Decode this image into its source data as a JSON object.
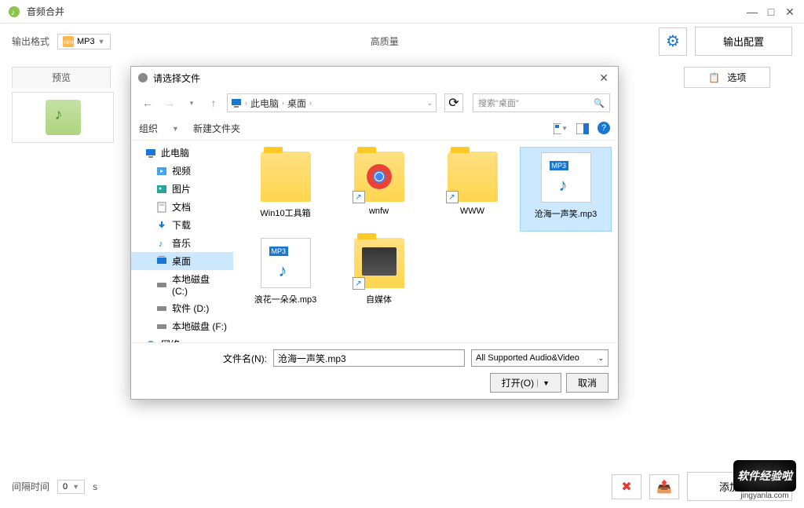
{
  "app": {
    "title": "音频合并"
  },
  "toolbar": {
    "format_label": "输出格式",
    "format_value": "MP3",
    "quality": "高质量",
    "output_config": "输出配置"
  },
  "main": {
    "preview_tab": "预览",
    "option_btn": "选项"
  },
  "bottom": {
    "interval_label": "间隔时间",
    "interval_value": "0",
    "interval_unit": "s",
    "add_file": "添加文件"
  },
  "dialog": {
    "title": "请选择文件",
    "breadcrumb": [
      "此电脑",
      "桌面"
    ],
    "search_placeholder": "搜索\"桌面\"",
    "organize": "组织",
    "new_folder": "新建文件夹",
    "sidebar": [
      {
        "label": "此电脑",
        "icon": "pc",
        "level": 1
      },
      {
        "label": "视频",
        "icon": "video",
        "level": 2
      },
      {
        "label": "图片",
        "icon": "image",
        "level": 2
      },
      {
        "label": "文档",
        "icon": "doc",
        "level": 2
      },
      {
        "label": "下载",
        "icon": "download",
        "level": 2
      },
      {
        "label": "音乐",
        "icon": "music",
        "level": 2
      },
      {
        "label": "桌面",
        "icon": "desktop",
        "level": 2,
        "selected": true
      },
      {
        "label": "本地磁盘 (C:)",
        "icon": "disk",
        "level": 2
      },
      {
        "label": "软件 (D:)",
        "icon": "disk",
        "level": 2
      },
      {
        "label": "本地磁盘 (F:)",
        "icon": "disk",
        "level": 2
      },
      {
        "label": "网络",
        "icon": "network",
        "level": 1
      }
    ],
    "files": [
      {
        "name": "Win10工具箱",
        "type": "folder"
      },
      {
        "name": "wnfw",
        "type": "folder-chrome",
        "shortcut": true
      },
      {
        "name": "WWW",
        "type": "folder",
        "shortcut": true
      },
      {
        "name": "沧海一声笑.mp3",
        "type": "mp3",
        "selected": true
      },
      {
        "name": "浪花一朵朵.mp3",
        "type": "mp3"
      },
      {
        "name": "自媒体",
        "type": "folder-media",
        "shortcut": true
      }
    ],
    "filename_label": "文件名(N):",
    "filename_value": "沧海一声笑.mp3",
    "filter": "All Supported Audio&Video",
    "open_btn": "打开(O)",
    "cancel_btn": "取消"
  },
  "watermark": {
    "text": "软件经验啦",
    "url": "jingyanla.com"
  }
}
